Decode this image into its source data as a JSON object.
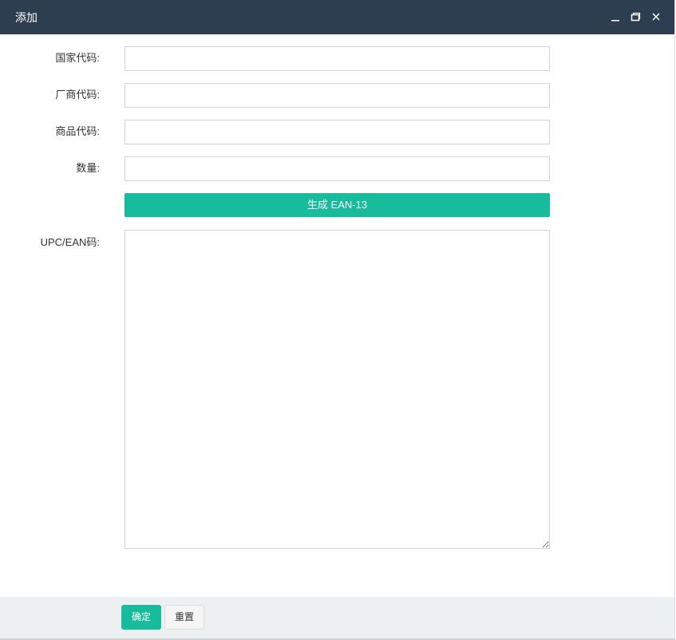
{
  "dialog": {
    "title": "添加",
    "controls": [
      "minimize-icon",
      "maximize-icon",
      "close-icon"
    ]
  },
  "form": {
    "country_code": {
      "label": "国家代码:",
      "value": ""
    },
    "manufacturer_code": {
      "label": "厂商代码:",
      "value": ""
    },
    "product_code": {
      "label": "商品代码:",
      "value": ""
    },
    "quantity": {
      "label": "数量:",
      "value": ""
    },
    "generate_label": "生成 EAN-13",
    "upc_ean": {
      "label": "UPC/EAN码:",
      "value": ""
    }
  },
  "footer": {
    "ok_label": "确定",
    "reset_label": "重置"
  },
  "colors": {
    "titlebar": "#2e3e51",
    "accent": "#18bc9c",
    "footer_bg": "#ecf0f1"
  }
}
